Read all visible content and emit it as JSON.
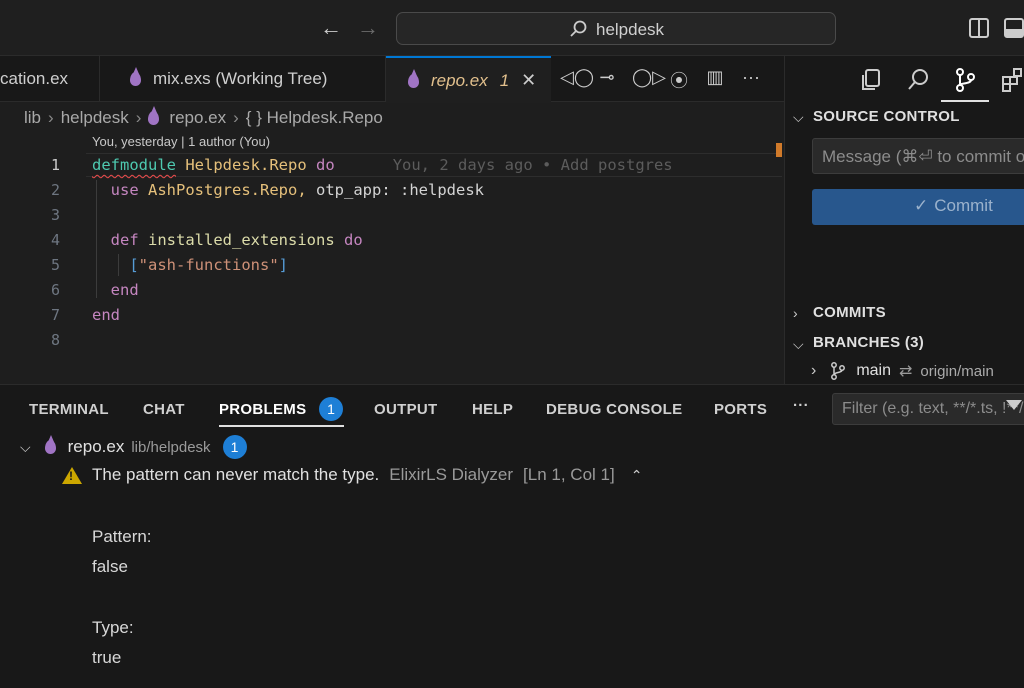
{
  "titlebar": {
    "back_icon": "arrow-left-icon",
    "forward_icon": "arrow-right-icon",
    "command_center": "helpdesk",
    "layout_icons": [
      "toggle-primary-sidebar-icon",
      "toggle-panel-icon"
    ]
  },
  "tabs": [
    {
      "label": "cation.ex"
    },
    {
      "label": "mix.exs (Working Tree)"
    },
    {
      "label": "repo.ex",
      "problems": "1",
      "active": true
    }
  ],
  "tab_actions": [
    "◁◯",
    "⊸",
    "◯▷",
    "⦿",
    "▥",
    "···"
  ],
  "breadcrumb": [
    "lib",
    "helpdesk",
    "repo.ex",
    "{ } Helpdesk.Repo"
  ],
  "editor": {
    "codelens": "You, yesterday | 1 author (You)",
    "line_numbers": [
      "1",
      "2",
      "3",
      "4",
      "5",
      "6",
      "7",
      "8"
    ],
    "blame": "You, 2 days ago • Add postgres",
    "tokens": {
      "defmodule": "defmodule",
      "module_name": "Helpdesk.Repo",
      "do": "do",
      "use": "use",
      "use_target": "AshPostgres.Repo,",
      "otp_key": "otp_app:",
      "otp_val": ":helpdesk",
      "def": "def",
      "fn_name": "installed_extensions",
      "do2": "do",
      "br_open": "[",
      "string": "\"ash-functions\"",
      "br_close": "]",
      "end_inner": "end",
      "end_outer": "end"
    }
  },
  "sidebar": {
    "source_control_title": "SOURCE CONTROL",
    "message_placeholder": "Message (⌘⏎ to commit on 'main')",
    "commit_label": "Commit",
    "commits_title": "COMMITS",
    "branches_title": "BRANCHES (3)",
    "branch": {
      "name": "main",
      "remote": "origin/main"
    }
  },
  "panel": {
    "tabs": [
      "TERMINAL",
      "CHAT",
      "PROBLEMS",
      "OUTPUT",
      "HELP",
      "DEBUG CONSOLE",
      "PORTS",
      "···"
    ],
    "problems_count": "1",
    "filter_placeholder": "Filter (e.g. text, **/*.ts, !**/node_modules/**)",
    "file": {
      "name": "repo.ex",
      "path": "lib/helpdesk",
      "count": "1"
    },
    "problem": {
      "message": "The pattern can never match the type.",
      "source": "ElixirLS Dialyzer",
      "location": "[Ln 1, Col 1]"
    },
    "details": [
      "Pattern:",
      "false",
      "Type:",
      "true"
    ]
  }
}
